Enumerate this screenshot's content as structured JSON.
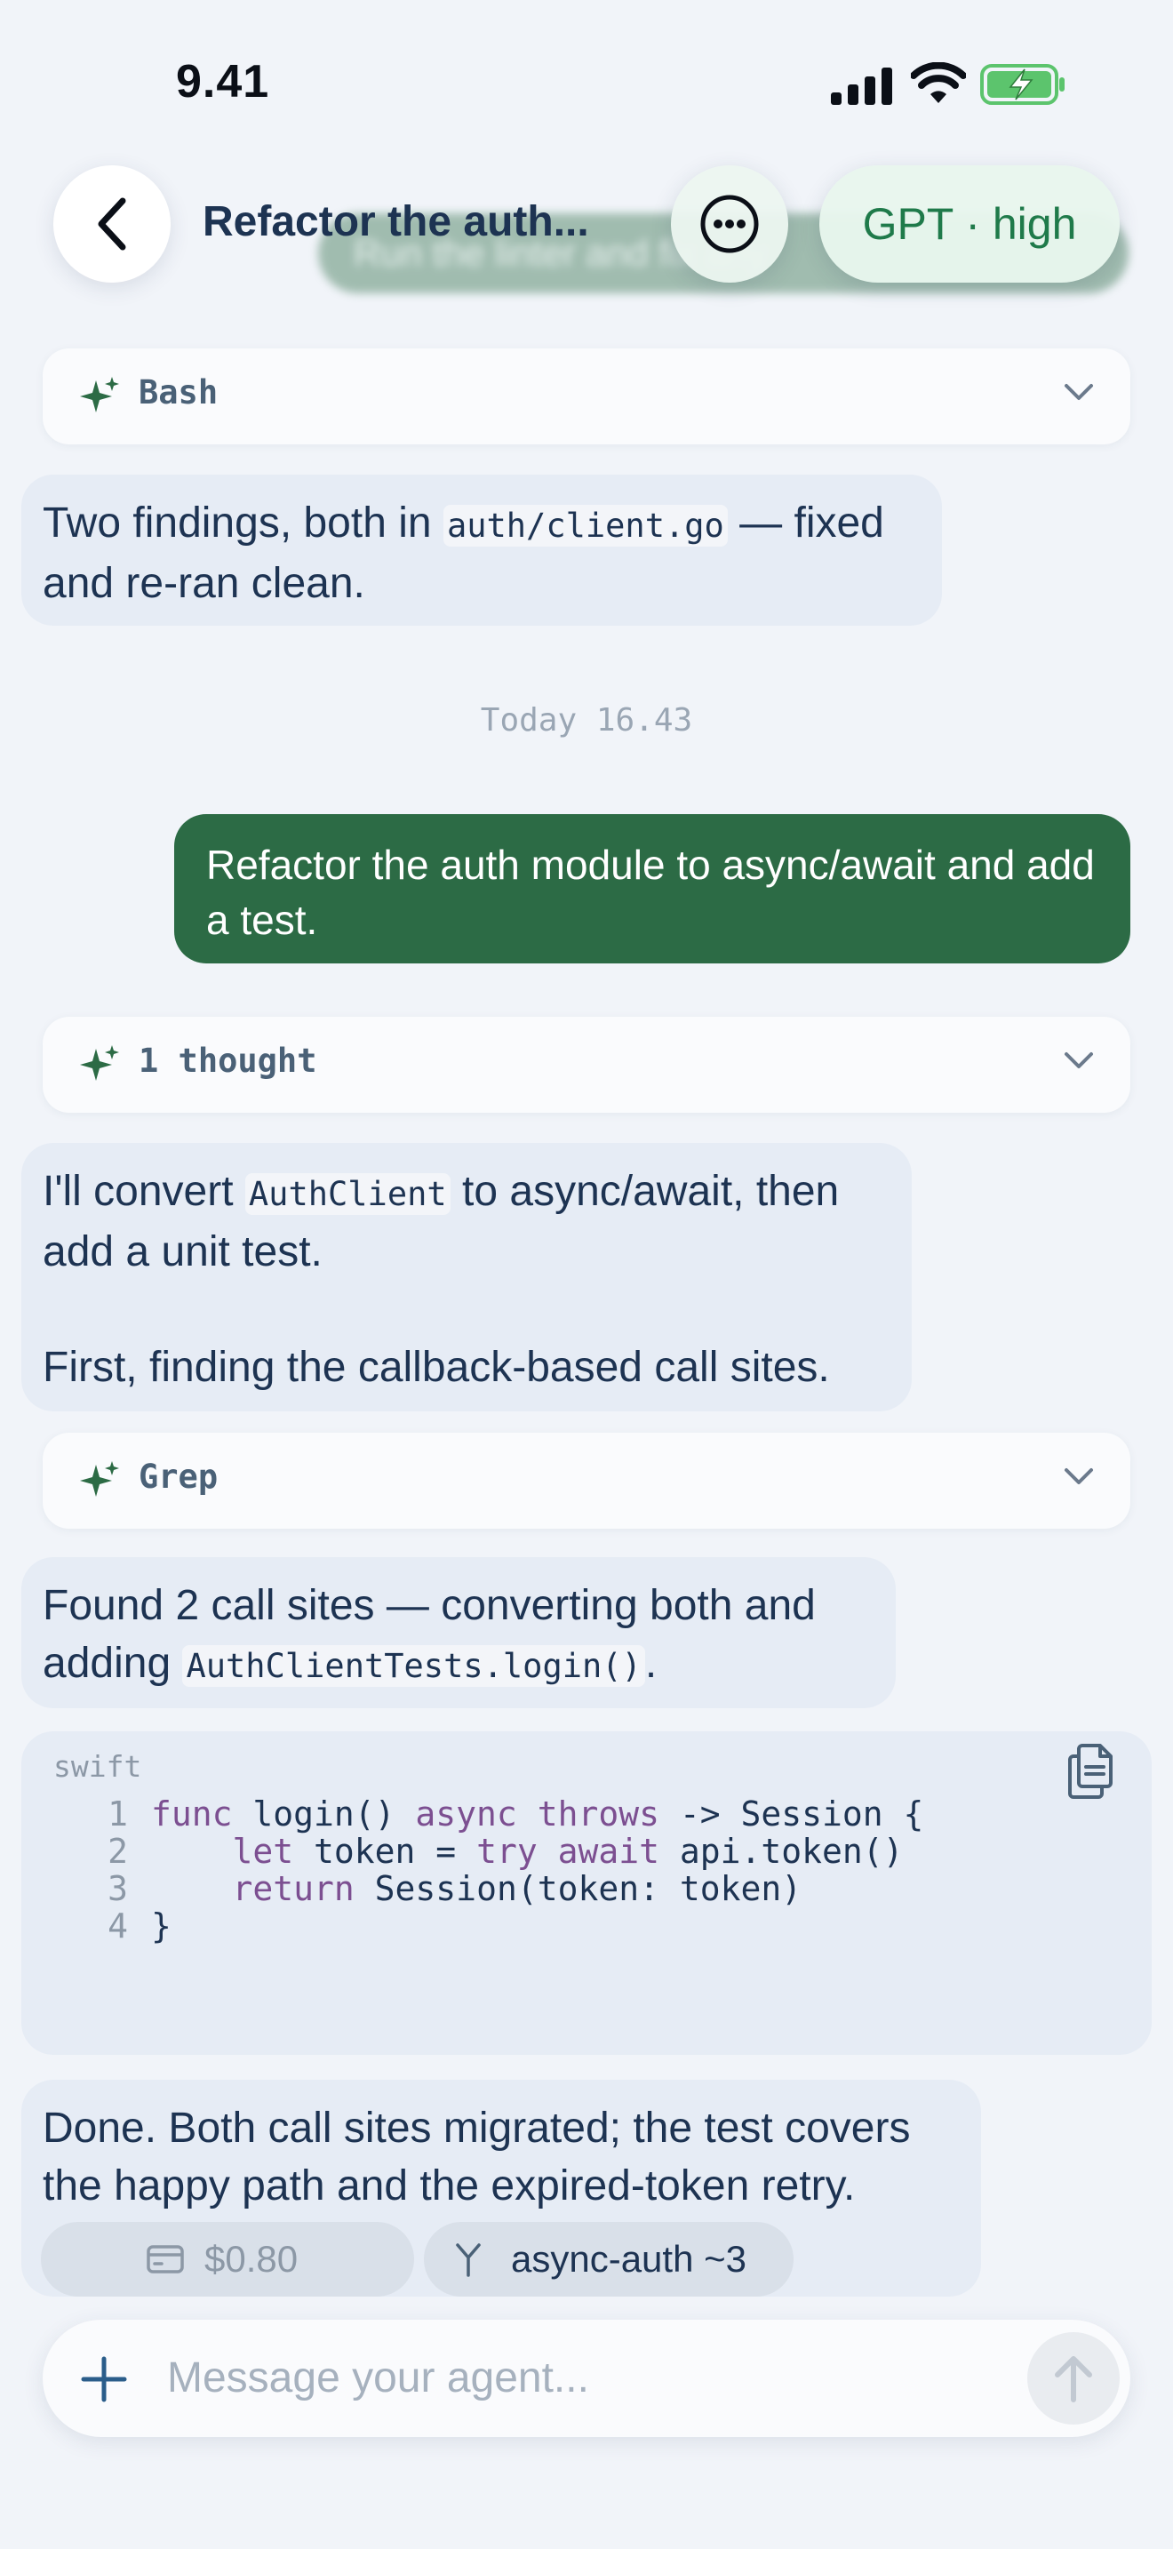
{
  "status_bar": {
    "time": "9.41"
  },
  "header": {
    "title": "Refactor the auth...",
    "ghost_text": "Run the linter and fix any",
    "model_label": "GPT · high"
  },
  "tools": {
    "bash": "Bash",
    "thought": "1 thought",
    "grep": "Grep"
  },
  "messages": {
    "m1": {
      "before": "Two findings, both in ",
      "code": "auth/client.go",
      "after": " — fixed and re-ran clean."
    },
    "timestamp": "Today 16.43",
    "user": "Refactor the auth module to async/await and add a test.",
    "m2": {
      "before": "I'll convert ",
      "code": "AuthClient",
      "after": " to async/await, then add a unit test.",
      "line2": "First, finding the callback-based call sites."
    },
    "m3": {
      "before": "Found 2 call sites — converting both and adding ",
      "code": "AuthClientTests.login()",
      "after": "."
    },
    "m4": "Done. Both call sites migrated; the test covers the happy path and the expired-token retry."
  },
  "code_block": {
    "language": "swift",
    "lines": [
      {
        "n": "1",
        "parts": [
          [
            "kw",
            "func"
          ],
          [
            "t",
            " login() "
          ],
          [
            "kw",
            "async throws"
          ],
          [
            "t",
            " -> Session {"
          ]
        ]
      },
      {
        "n": "2",
        "parts": [
          [
            "t",
            "    "
          ],
          [
            "kw",
            "let"
          ],
          [
            "t",
            " token = "
          ],
          [
            "kw",
            "try await"
          ],
          [
            "t",
            " api.token()"
          ]
        ]
      },
      {
        "n": "3",
        "parts": [
          [
            "t",
            "    "
          ],
          [
            "kw",
            "return"
          ],
          [
            "t",
            " Session(token: token)"
          ]
        ]
      },
      {
        "n": "4",
        "parts": [
          [
            "t",
            "}"
          ]
        ]
      }
    ]
  },
  "chips": {
    "cost": "$0.80",
    "branch": "async-auth ~3"
  },
  "composer": {
    "placeholder": "Message your agent..."
  },
  "colors": {
    "accent": "#2c6b45",
    "bubble": "#e6ecf5",
    "keyword": "#7c4f91"
  }
}
